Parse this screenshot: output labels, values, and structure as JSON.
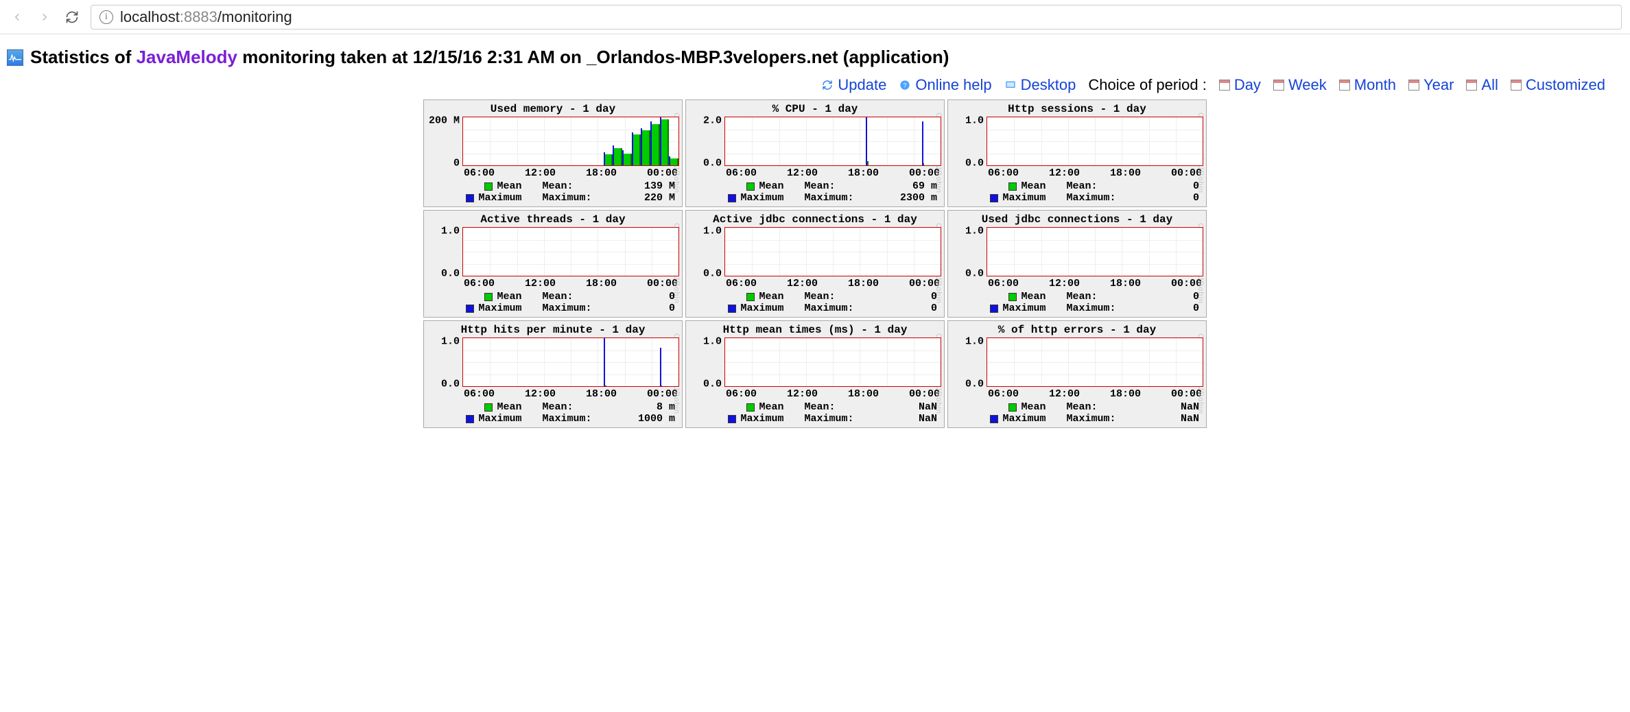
{
  "browser": {
    "url_host": "localhost",
    "url_port": ":8883",
    "url_path": "/monitoring"
  },
  "header": {
    "prefix": "Statistics of ",
    "jm_link": "JavaMelody",
    "suffix": " monitoring taken at 12/15/16 2:31 AM on _Orlandos-MBP.3velopers.net (application)"
  },
  "toolbar": {
    "update": "Update",
    "help": "Online help",
    "desktop": "Desktop",
    "period_label": "Choice of period :",
    "periods": {
      "day": "Day",
      "week": "Week",
      "month": "Month",
      "year": "Year",
      "all": "All",
      "custom": "Customized"
    }
  },
  "legend_labels": {
    "mean": "Mean",
    "mean_stat": "Mean:",
    "max": "Maximum",
    "max_stat": "Maximum:"
  },
  "watermark": "Created with JRobin",
  "chart_data": [
    {
      "title": "Used memory - 1 day",
      "type": "area",
      "y_ticks": [
        "200 M",
        "0"
      ],
      "x_ticks": [
        "06:00",
        "12:00",
        "18:00",
        "00:00"
      ],
      "ylim": [
        0,
        220
      ],
      "y_unit": "M",
      "mean": "139 M",
      "max": "220 M",
      "has_data": true,
      "series": [
        {
          "name": "Mean",
          "color": "green",
          "values_approx": [
            0,
            0,
            0,
            0,
            0,
            0,
            0,
            0,
            0,
            0,
            0,
            0,
            0,
            0,
            0,
            50,
            80,
            55,
            140,
            160,
            190,
            210,
            30
          ]
        },
        {
          "name": "Maximum",
          "color": "blue",
          "values_approx": [
            0,
            0,
            0,
            0,
            0,
            0,
            0,
            0,
            0,
            0,
            0,
            0,
            0,
            0,
            0,
            60,
            90,
            70,
            150,
            170,
            200,
            220,
            40
          ]
        }
      ]
    },
    {
      "title": "% CPU - 1 day",
      "type": "line",
      "y_ticks": [
        "2.0",
        "0.0"
      ],
      "x_ticks": [
        "06:00",
        "12:00",
        "18:00",
        "00:00"
      ],
      "ylim": [
        0,
        2.3
      ],
      "y_unit": "m",
      "mean": "69 m",
      "max": "2300 m",
      "has_data": true,
      "series": [
        {
          "name": "Mean",
          "color": "green",
          "values_approx": [
            0,
            0,
            0,
            0,
            0,
            0,
            0,
            0,
            0,
            0,
            0,
            0,
            0,
            0,
            0,
            0.2,
            0,
            0,
            0,
            0,
            0,
            0.1,
            0
          ]
        },
        {
          "name": "Maximum",
          "color": "blue",
          "values_approx": [
            0,
            0,
            0,
            0,
            0,
            0,
            0,
            0,
            0,
            0,
            0,
            0,
            0,
            0,
            0,
            2.3,
            0,
            0,
            0,
            0,
            0,
            2.1,
            0
          ]
        }
      ]
    },
    {
      "title": "Http sessions - 1 day",
      "type": "line",
      "y_ticks": [
        "1.0",
        "0.0"
      ],
      "x_ticks": [
        "06:00",
        "12:00",
        "18:00",
        "00:00"
      ],
      "ylim": [
        0,
        1
      ],
      "mean": "0",
      "max": "0",
      "has_data": false
    },
    {
      "title": "Active threads - 1 day",
      "type": "line",
      "y_ticks": [
        "1.0",
        "0.0"
      ],
      "x_ticks": [
        "06:00",
        "12:00",
        "18:00",
        "00:00"
      ],
      "ylim": [
        0,
        1
      ],
      "mean": "0",
      "max": "0",
      "has_data": false
    },
    {
      "title": "Active jdbc connections - 1 day",
      "type": "line",
      "y_ticks": [
        "1.0",
        "0.0"
      ],
      "x_ticks": [
        "06:00",
        "12:00",
        "18:00",
        "00:00"
      ],
      "ylim": [
        0,
        1
      ],
      "mean": "0",
      "max": "0",
      "has_data": false
    },
    {
      "title": "Used jdbc connections - 1 day",
      "type": "line",
      "y_ticks": [
        "1.0",
        "0.0"
      ],
      "x_ticks": [
        "06:00",
        "12:00",
        "18:00",
        "00:00"
      ],
      "ylim": [
        0,
        1
      ],
      "mean": "0",
      "max": "0",
      "has_data": false
    },
    {
      "title": "Http hits per minute - 1 day",
      "type": "line",
      "y_ticks": [
        "1.0",
        "0.0"
      ],
      "x_ticks": [
        "06:00",
        "12:00",
        "18:00",
        "00:00"
      ],
      "ylim": [
        0,
        1.0
      ],
      "y_unit": "m",
      "mean": "8 m",
      "max": "1000 m",
      "has_data": true,
      "series": [
        {
          "name": "Mean",
          "color": "green",
          "values_approx": [
            0,
            0,
            0,
            0,
            0,
            0,
            0,
            0,
            0,
            0,
            0,
            0,
            0,
            0,
            0,
            0.02,
            0,
            0,
            0,
            0,
            0,
            0.01,
            0
          ]
        },
        {
          "name": "Maximum",
          "color": "blue",
          "values_approx": [
            0,
            0,
            0,
            0,
            0,
            0,
            0,
            0,
            0,
            0,
            0,
            0,
            0,
            0,
            0,
            1.0,
            0,
            0,
            0,
            0,
            0,
            0.8,
            0
          ]
        }
      ]
    },
    {
      "title": "Http mean times (ms) - 1 day",
      "type": "line",
      "y_ticks": [
        "1.0",
        "0.0"
      ],
      "x_ticks": [
        "06:00",
        "12:00",
        "18:00",
        "00:00"
      ],
      "ylim": [
        0,
        1
      ],
      "mean": "NaN",
      "max": "NaN",
      "has_data": false
    },
    {
      "title": "% of http errors - 1 day",
      "type": "line",
      "y_ticks": [
        "1.0",
        "0.0"
      ],
      "x_ticks": [
        "06:00",
        "12:00",
        "18:00",
        "00:00"
      ],
      "ylim": [
        0,
        1
      ],
      "mean": "NaN",
      "max": "NaN",
      "has_data": false
    }
  ]
}
